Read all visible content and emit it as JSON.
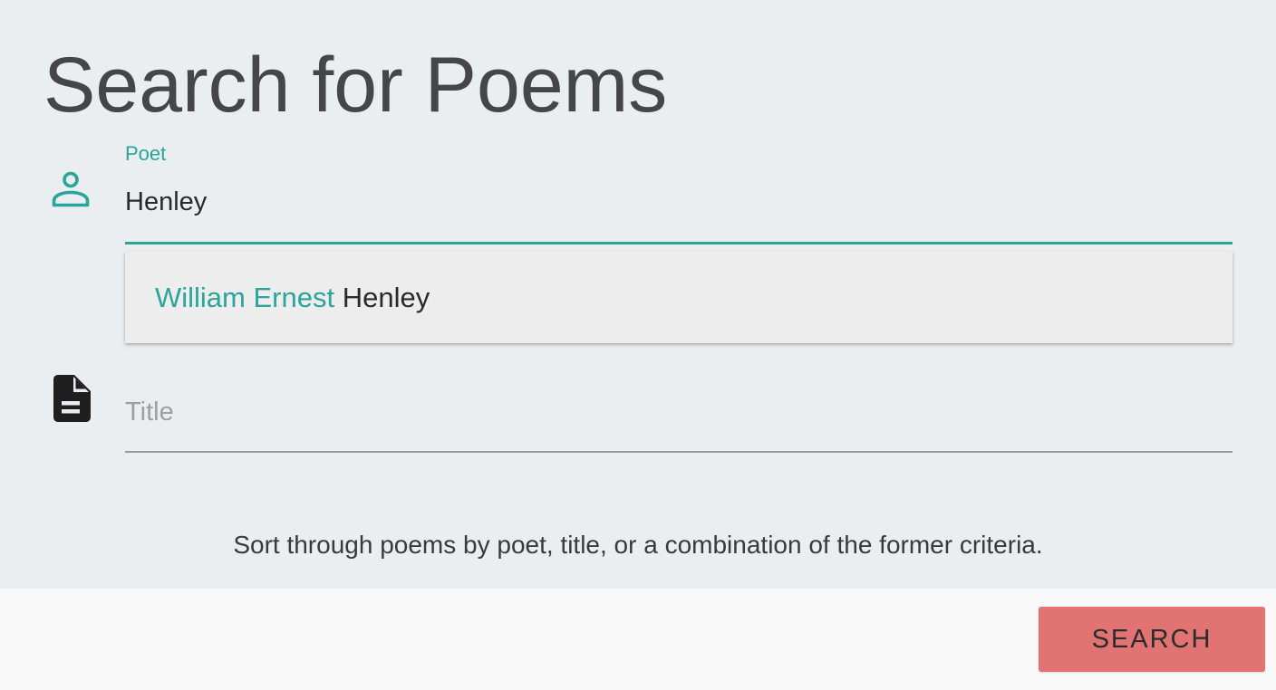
{
  "page": {
    "title": "Search for Poems"
  },
  "poet_field": {
    "label": "Poet",
    "value": "Henley",
    "icon": "person-icon"
  },
  "autocomplete": {
    "suggestions": [
      {
        "prefix": "William Ernest ",
        "match": "Henley"
      }
    ]
  },
  "title_field": {
    "placeholder": "Title",
    "value": "",
    "icon": "document-icon"
  },
  "description": "Sort through poems by poet, title, or a combination of the former criteria.",
  "actions": {
    "search_label": "SEARCH"
  },
  "colors": {
    "accent": "#2aa59a",
    "button": "#e27373",
    "background": "#eaeef1",
    "footer": "#f9f9f9",
    "dropdown": "#ededed"
  }
}
